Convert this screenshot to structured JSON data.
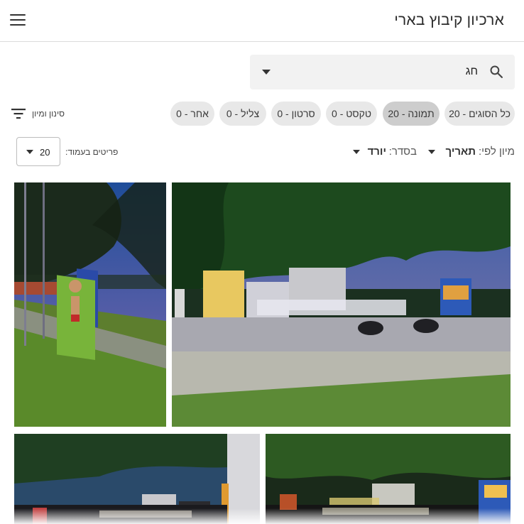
{
  "app": {
    "title": "ארכיון קיבוץ בארי"
  },
  "search": {
    "value": "חג"
  },
  "type_chips": [
    {
      "label": "כל הסוגים - 20",
      "active": false
    },
    {
      "label": "תמונה - 20",
      "active": true
    },
    {
      "label": "טקסט - 0",
      "active": false
    },
    {
      "label": "סרטון - 0",
      "active": false
    },
    {
      "label": "צליל - 0",
      "active": false
    },
    {
      "label": "אחר - 0",
      "active": false
    }
  ],
  "filter": {
    "label": "סינון ומיון"
  },
  "sort": {
    "field_label": "מיון לפי:",
    "field_value": "תאריך",
    "order_label": "בסדר:",
    "order_value": "יורד"
  },
  "per_page": {
    "label": "פריטים בעמוד:",
    "value": "20"
  },
  "gallery": {
    "photos": [
      {
        "name": "archive-photo-1"
      },
      {
        "name": "archive-photo-2"
      },
      {
        "name": "archive-photo-3"
      },
      {
        "name": "archive-photo-4"
      }
    ]
  },
  "icons": {
    "menu": "hamburger-icon",
    "search": "search-icon",
    "filter": "filter-sort-icon",
    "dropdown": "caret-down-icon"
  },
  "colors": {
    "chip_bg": "#e8e8e8",
    "chip_active_bg": "#cdcdcd",
    "search_bg": "#f2f2f2",
    "divider": "#dcdcdc"
  }
}
